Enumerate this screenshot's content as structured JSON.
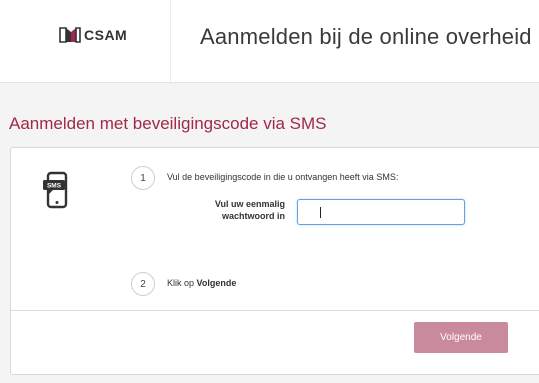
{
  "header": {
    "logo_text": "CSAM",
    "title": "Aanmelden bij de online overheid"
  },
  "section": {
    "title": "Aanmelden met beveiligingscode via SMS"
  },
  "phone_icon": {
    "badge_text": "SMS"
  },
  "steps": [
    {
      "number": "1",
      "text": "Vul de beveiligingscode in die u ontvangen heeft via SMS:"
    },
    {
      "number": "2",
      "text_prefix": "Klik op ",
      "text_bold": "Volgende"
    }
  ],
  "otp": {
    "label": "Vul uw eenmalig wachtwoord in",
    "value": ""
  },
  "actions": {
    "next_label": "Volgende"
  },
  "colors": {
    "accent": "#a02948",
    "button_disabled": "#c98a9b",
    "input_focus": "#6aa0d9"
  }
}
